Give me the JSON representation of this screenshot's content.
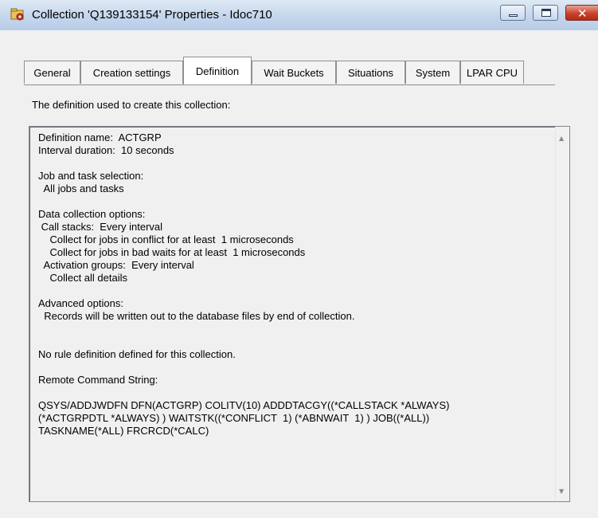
{
  "window": {
    "title": "Collection 'Q139133154' Properties - Idoc710"
  },
  "tabs": [
    {
      "label": "General"
    },
    {
      "label": "Creation settings"
    },
    {
      "label": "Definition"
    },
    {
      "label": "Wait Buckets"
    },
    {
      "label": "Situations"
    },
    {
      "label": "System"
    },
    {
      "label": "LPAR CPU"
    }
  ],
  "active_tab": "Definition",
  "definition": {
    "intro": "The definition used to create this collection:",
    "lines": [
      "Definition name:  ACTGRP",
      "Interval duration:  10 seconds",
      "",
      "Job and task selection:",
      "  All jobs and tasks",
      "",
      "Data collection options:",
      " Call stacks:  Every interval",
      "    Collect for jobs in conflict for at least  1 microseconds",
      "    Collect for jobs in bad waits for at least  1 microseconds",
      "  Activation groups:  Every interval",
      "    Collect all details",
      "",
      "Advanced options:",
      "  Records will be written out to the database files by end of collection.",
      "",
      "",
      "No rule definition defined for this collection.",
      "",
      "Remote Command String:",
      "",
      "QSYS/ADDJWDFN DFN(ACTGRP) COLITV(10) ADDDTACGY((*CALLSTACK *ALWAYS)",
      "(*ACTGRPDTL *ALWAYS) ) WAITSTK((*CONFLICT  1) (*ABNWAIT  1) ) JOB((*ALL))",
      "TASKNAME(*ALL) FRCRCD(*CALC)"
    ]
  },
  "icons": {
    "app": "collection-icon",
    "minimize": "minimize-icon",
    "maximize": "maximize-icon",
    "close": "close-icon",
    "scroll_up": "scroll-up-arrow-icon",
    "scroll_down": "scroll-down-arrow-icon"
  },
  "colors": {
    "titlebar": "#c4d6ec",
    "close_button": "#c8432b",
    "panel": "#f0f0f0"
  }
}
